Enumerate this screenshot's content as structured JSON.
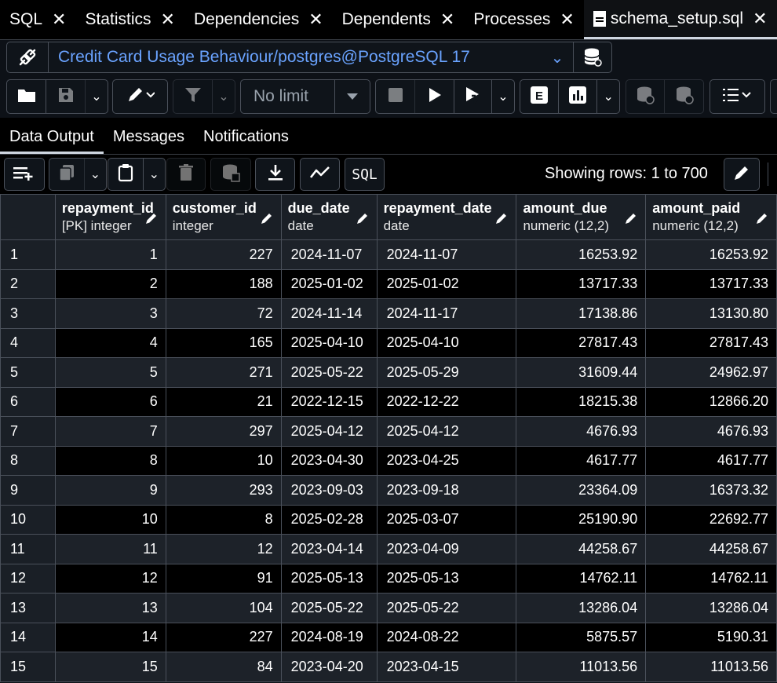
{
  "tabs": [
    {
      "label": "SQL"
    },
    {
      "label": "Statistics"
    },
    {
      "label": "Dependencies"
    },
    {
      "label": "Dependents"
    },
    {
      "label": "Processes"
    },
    {
      "label": "schema_setup.sql"
    }
  ],
  "connection": {
    "title": "Credit Card Usage Behaviour/postgres@PostgreSQL 17"
  },
  "toolbar": {
    "limit_value": "No limit"
  },
  "result_tabs": {
    "data_output": "Data Output",
    "messages": "Messages",
    "notifications": "Notifications"
  },
  "grid_toolbar": {
    "sql_label": "SQL",
    "rows_label": "Showing rows: 1 to 700"
  },
  "columns": [
    {
      "name": "repayment_id",
      "type": "[PK] integer"
    },
    {
      "name": "customer_id",
      "type": "integer"
    },
    {
      "name": "due_date",
      "type": "date"
    },
    {
      "name": "repayment_date",
      "type": "date"
    },
    {
      "name": "amount_due",
      "type": "numeric (12,2)"
    },
    {
      "name": "amount_paid",
      "type": "numeric (12,2)"
    }
  ],
  "rows": [
    [
      "1",
      "1",
      "227",
      "2024-11-07",
      "2024-11-07",
      "16253.92",
      "16253.92"
    ],
    [
      "2",
      "2",
      "188",
      "2025-01-02",
      "2025-01-02",
      "13717.33",
      "13717.33"
    ],
    [
      "3",
      "3",
      "72",
      "2024-11-14",
      "2024-11-17",
      "17138.86",
      "13130.80"
    ],
    [
      "4",
      "4",
      "165",
      "2025-04-10",
      "2025-04-10",
      "27817.43",
      "27817.43"
    ],
    [
      "5",
      "5",
      "271",
      "2025-05-22",
      "2025-05-29",
      "31609.44",
      "24962.97"
    ],
    [
      "6",
      "6",
      "21",
      "2022-12-15",
      "2022-12-22",
      "18215.38",
      "12866.20"
    ],
    [
      "7",
      "7",
      "297",
      "2025-04-12",
      "2025-04-12",
      "4676.93",
      "4676.93"
    ],
    [
      "8",
      "8",
      "10",
      "2023-04-30",
      "2023-04-25",
      "4617.77",
      "4617.77"
    ],
    [
      "9",
      "9",
      "293",
      "2023-09-03",
      "2023-09-18",
      "23364.09",
      "16373.32"
    ],
    [
      "10",
      "10",
      "8",
      "2025-02-28",
      "2025-03-07",
      "25190.90",
      "22692.77"
    ],
    [
      "11",
      "11",
      "12",
      "2023-04-14",
      "2023-04-09",
      "44258.67",
      "44258.67"
    ],
    [
      "12",
      "12",
      "91",
      "2025-05-13",
      "2025-05-13",
      "14762.11",
      "14762.11"
    ],
    [
      "13",
      "13",
      "104",
      "2025-05-22",
      "2025-05-22",
      "13286.04",
      "13286.04"
    ],
    [
      "14",
      "14",
      "227",
      "2024-08-19",
      "2024-08-22",
      "5875.57",
      "5190.31"
    ],
    [
      "15",
      "15",
      "84",
      "2023-04-20",
      "2023-04-15",
      "11013.56",
      "11013.56"
    ]
  ]
}
